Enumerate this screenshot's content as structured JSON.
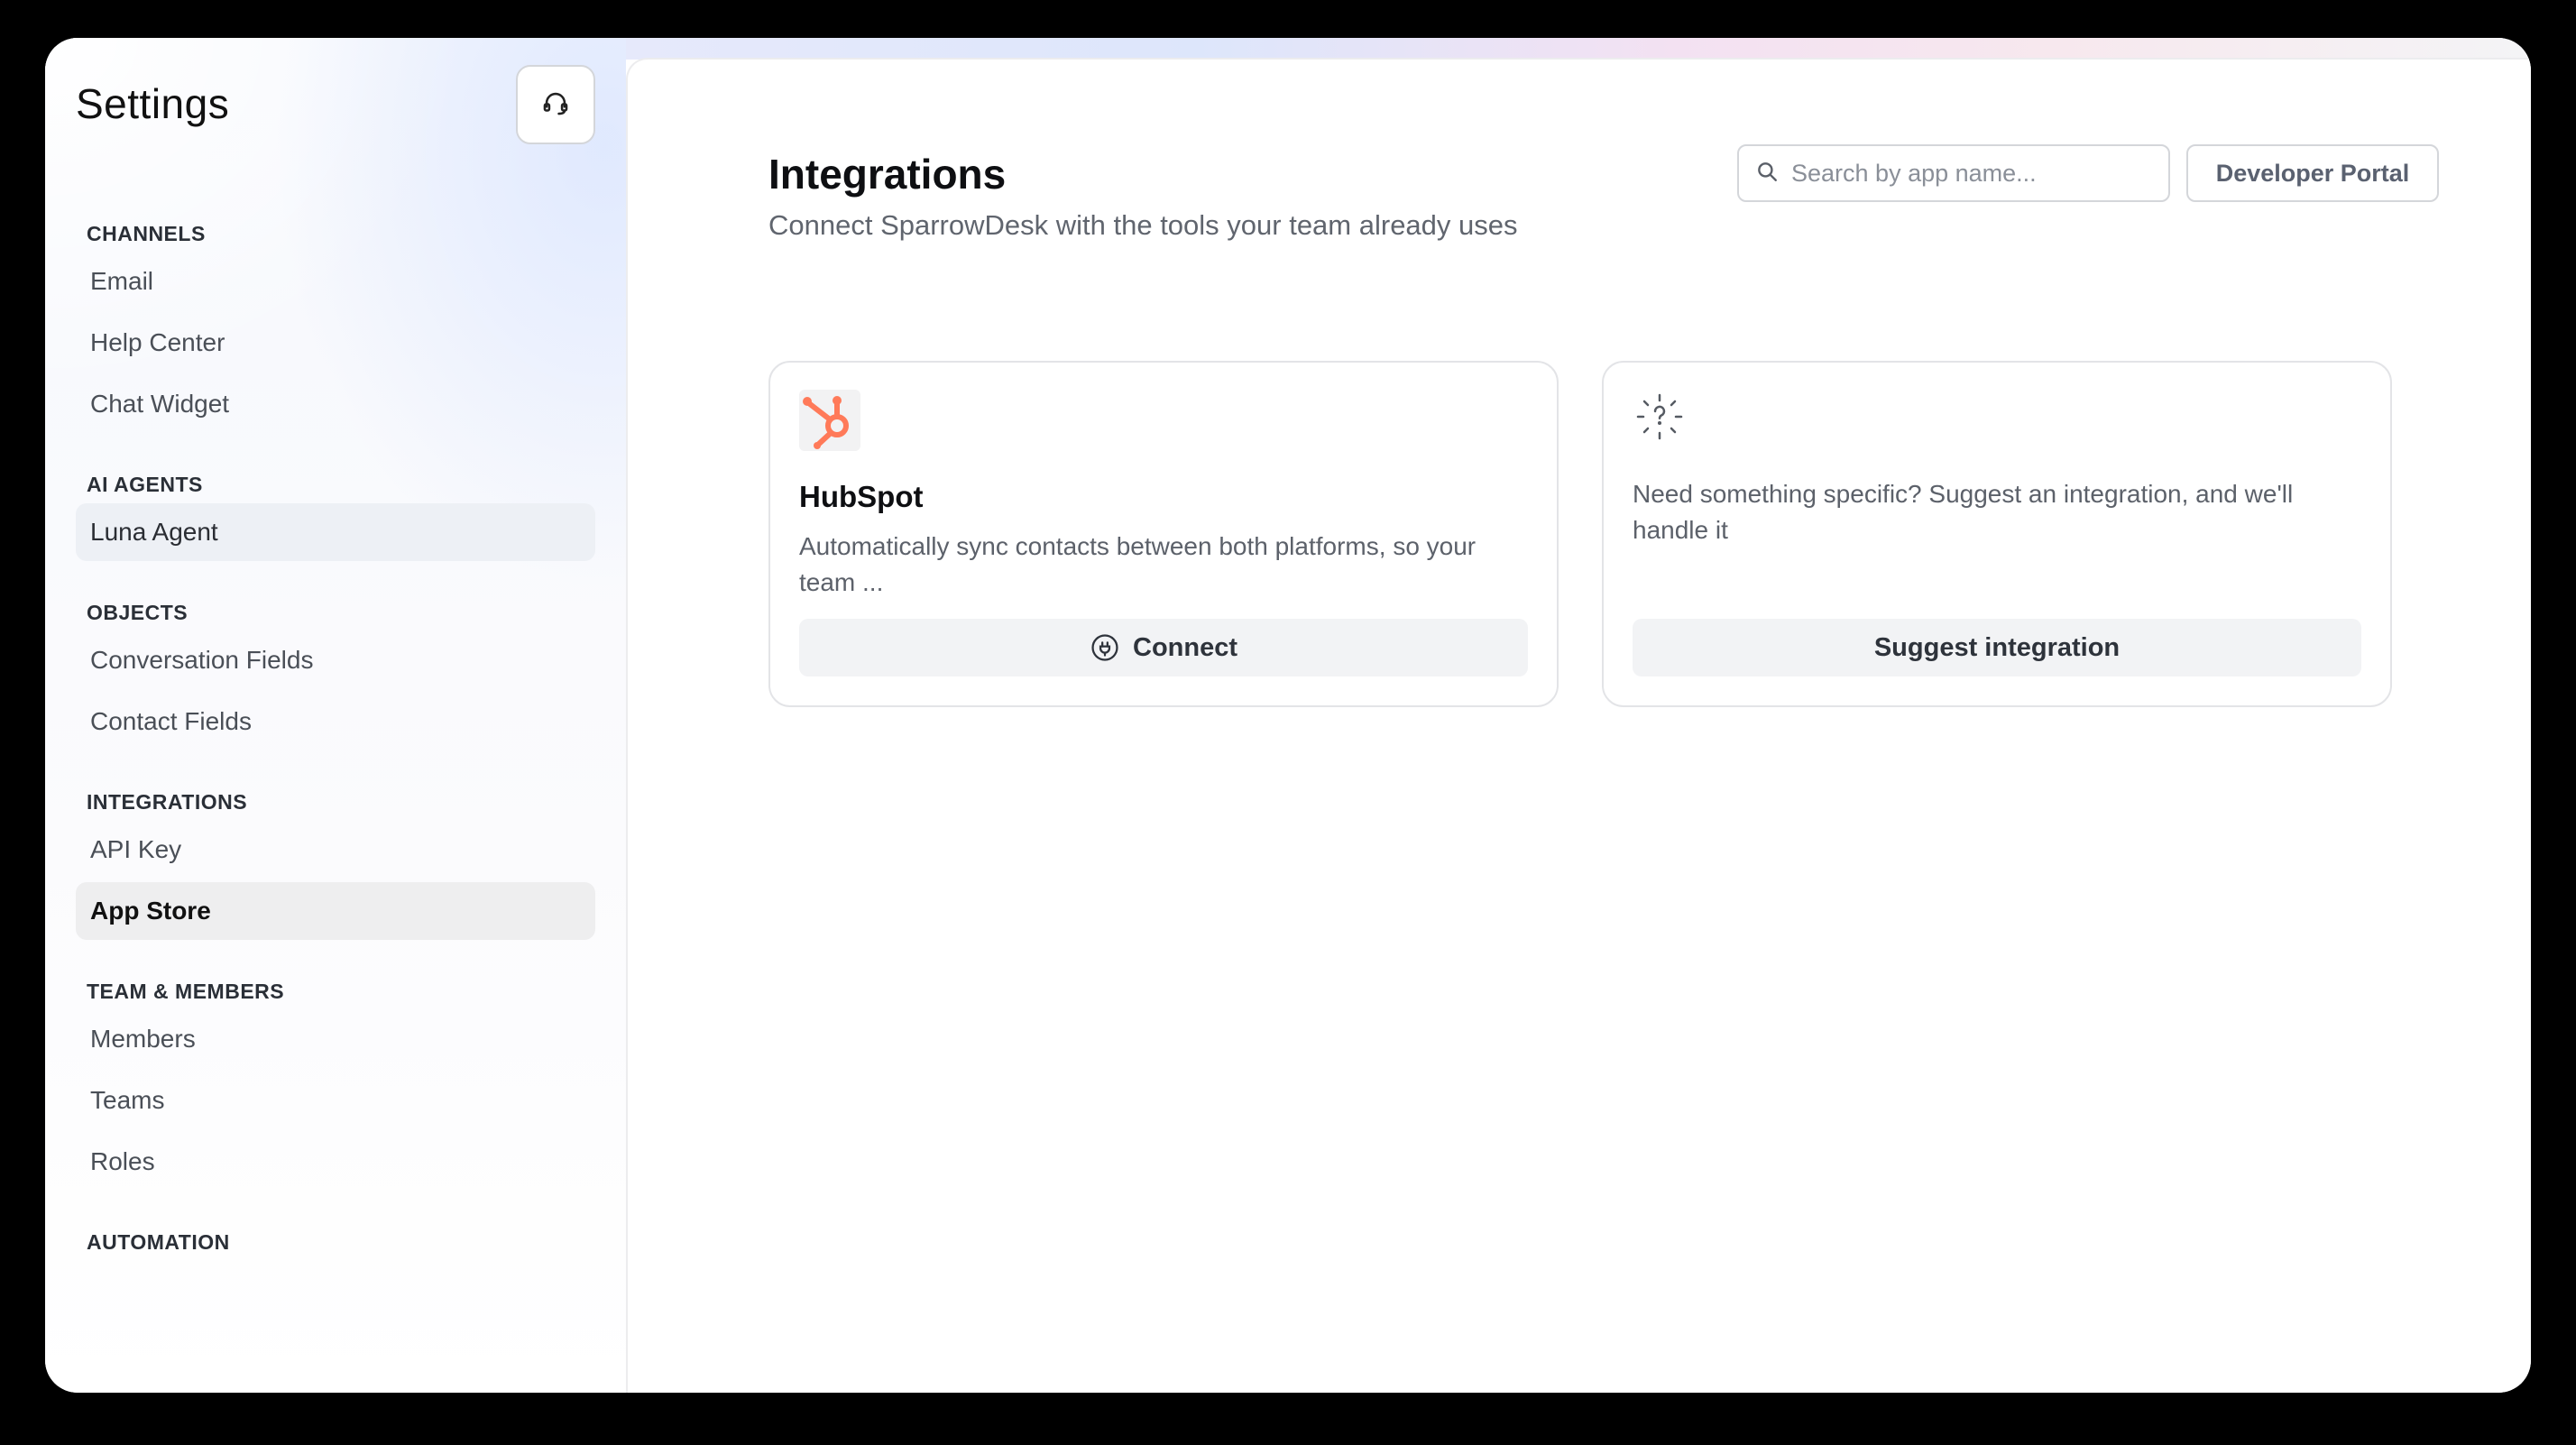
{
  "sidebar": {
    "title": "Settings",
    "sections": [
      {
        "label": "CHANNELS",
        "items": [
          "Email",
          "Help Center",
          "Chat Widget"
        ]
      },
      {
        "label": "AI AGENTS",
        "items": [
          "Luna Agent"
        ]
      },
      {
        "label": "OBJECTS",
        "items": [
          "Conversation Fields",
          "Contact Fields"
        ]
      },
      {
        "label": "INTEGRATIONS",
        "items": [
          "API Key",
          "App Store"
        ]
      },
      {
        "label": "TEAM & MEMBERS",
        "items": [
          "Members",
          "Teams",
          "Roles"
        ]
      },
      {
        "label": "AUTOMATION",
        "items": []
      }
    ],
    "active_item": "App Store",
    "highlighted_item": "Luna Agent"
  },
  "main": {
    "title": "Integrations",
    "subtitle": "Connect SparrowDesk with the tools your team already uses",
    "search": {
      "placeholder": "Search by app name..."
    },
    "developer_portal_label": "Developer Portal",
    "cards": [
      {
        "title": "HubSpot",
        "description": "Automatically sync contacts between both platforms, so your team ...",
        "button_label": "Connect",
        "icon": "hubspot-logo"
      },
      {
        "title": "",
        "description": "Need something specific? Suggest an integration, and we'll handle it",
        "button_label": "Suggest integration",
        "icon": "question-sparkle-icon"
      }
    ]
  },
  "colors": {
    "hubspot_orange": "#ff7a59",
    "active_nav_bg": "#eeeeef",
    "button_bg": "#f2f3f5"
  }
}
